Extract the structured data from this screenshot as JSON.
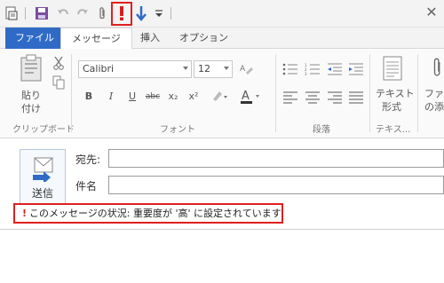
{
  "qat": {
    "icons": [
      "save-icon",
      "undo-icon",
      "redo-icon",
      "attach-icon",
      "high-importance-icon",
      "low-importance-icon",
      "customize-qat-icon"
    ],
    "close": "✕"
  },
  "tabs": {
    "file": "ファイル",
    "message": "メッセージ",
    "insert": "挿入",
    "options": "オプション"
  },
  "ribbon": {
    "clipboard": {
      "paste_line1": "貼り",
      "paste_line2": "付け",
      "label": "クリップボード"
    },
    "font": {
      "font_name": "Calibri",
      "font_size": "12",
      "label": "フォント",
      "bold": "B",
      "italic": "I",
      "underline": "U",
      "strike": "abc",
      "subscript": "x₂",
      "superscript": "x²"
    },
    "paragraph": {
      "label": "段落"
    },
    "text": {
      "line1": "テキスト",
      "line2": "形式",
      "label": "テキス..."
    },
    "attach": {
      "line1": "ファイ",
      "line2": "の添"
    }
  },
  "compose": {
    "send": "送信",
    "to_label": "宛先:",
    "subject_label": "件名",
    "notice_bang": "!",
    "notice": "このメッセージの状況: 重要度が '高' に設定されています"
  }
}
